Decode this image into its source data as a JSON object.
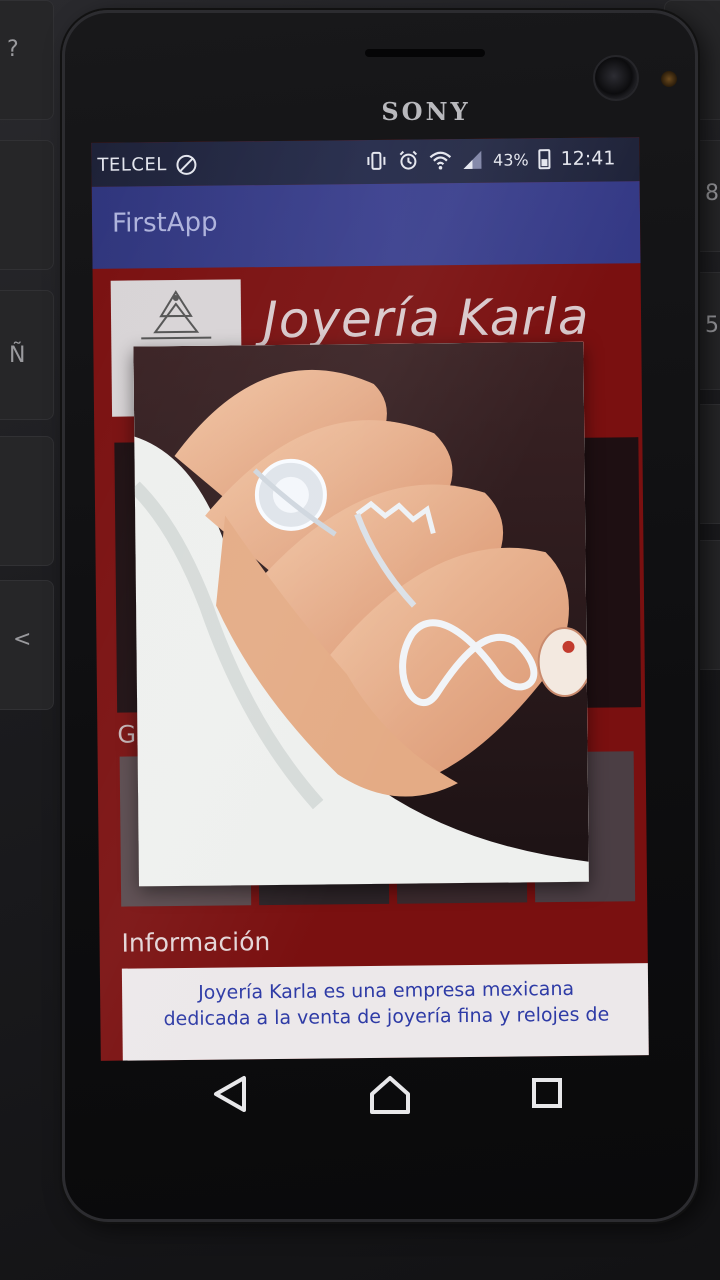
{
  "device": {
    "brand": "SONY"
  },
  "keyboard": {
    "keys": [
      "?",
      "Ñ",
      "<",
      "8",
      "5"
    ]
  },
  "status_bar": {
    "carrier": "TELCEL",
    "battery": "43%",
    "battery_level_percent": 43,
    "time": "12:41",
    "icons": [
      "no-sim-icon",
      "vibrate-icon",
      "alarm-icon",
      "wifi-icon",
      "signal-icon",
      "battery-icon"
    ]
  },
  "app_bar": {
    "title": "FirstApp"
  },
  "header": {
    "store_title": "Joyería Karla"
  },
  "gallery": {
    "heading": "G"
  },
  "info": {
    "heading": "Información",
    "text_line1": "Joyería Karla es una empresa mexicana",
    "text_line2": "dedicada a la venta de joyería fina y relojes de"
  },
  "navigation": {
    "icons": [
      "back-icon",
      "home-icon",
      "recents-icon"
    ]
  },
  "colors": {
    "app_bar": "#3a3f8e",
    "status_bar": "#242a4a",
    "screen_background": "#7a1010",
    "info_text": "#2e3ba6"
  }
}
